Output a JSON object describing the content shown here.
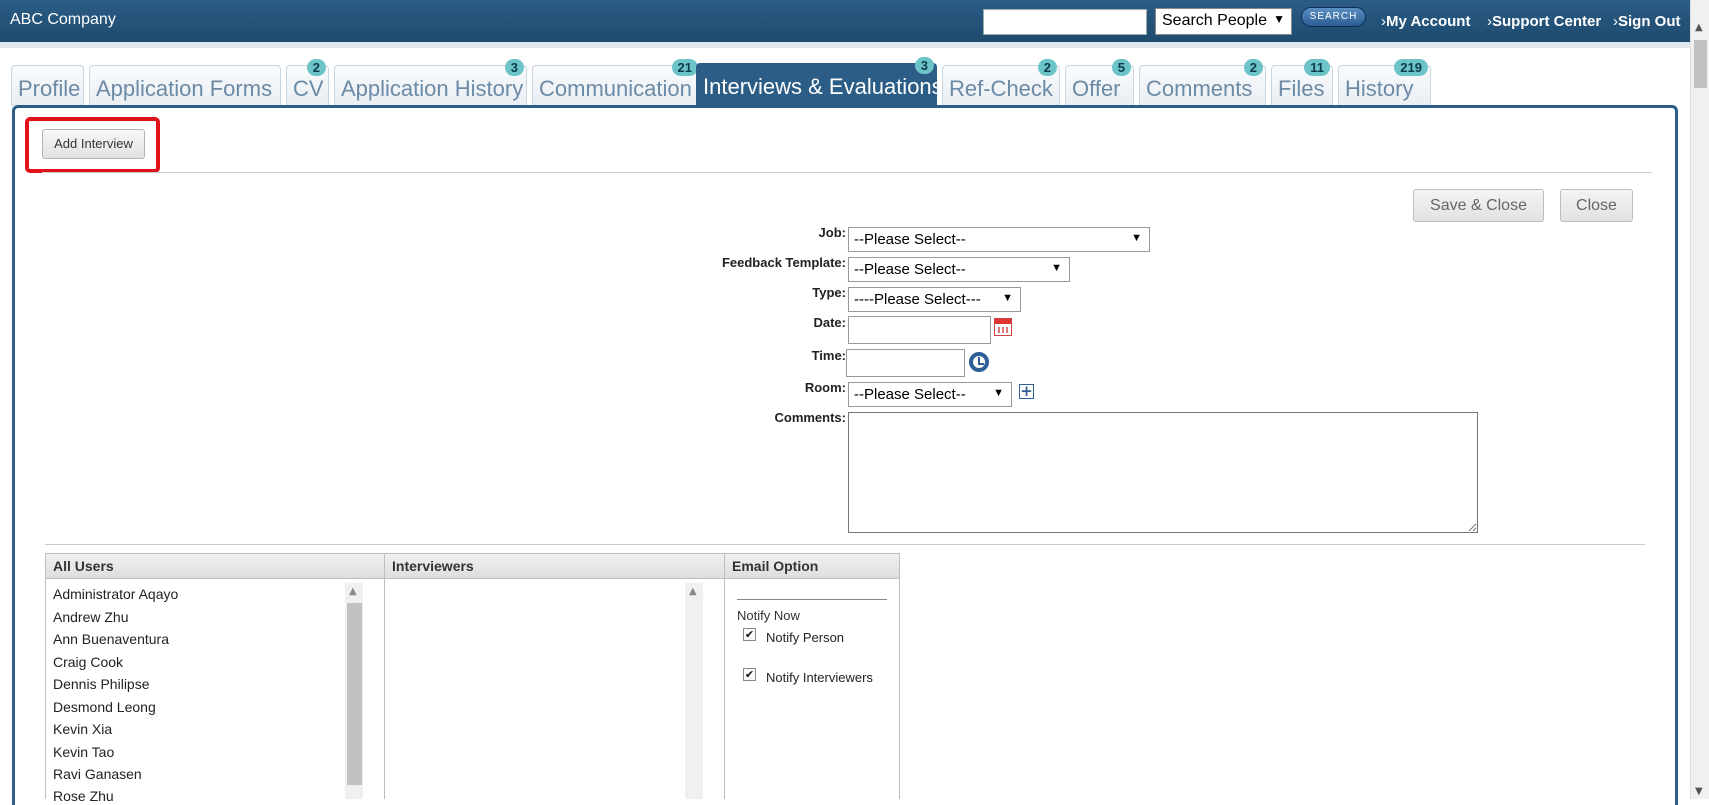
{
  "header": {
    "brand": "ABC Company",
    "search_value": "",
    "search_scope": "Search People",
    "search_button": "SEARCH",
    "links": [
      "My Account",
      "Support Center",
      "Sign Out"
    ]
  },
  "tabs": [
    {
      "label": "Profile",
      "badge": ""
    },
    {
      "label": "Application Forms",
      "badge": ""
    },
    {
      "label": "CV",
      "badge": "2"
    },
    {
      "label": "Application History",
      "badge": "3"
    },
    {
      "label": "Communication",
      "badge": "21"
    },
    {
      "label": "Interviews & Evaluations",
      "badge": "3",
      "active": true
    },
    {
      "label": "Ref-Check",
      "badge": "2"
    },
    {
      "label": "Offer",
      "badge": "5"
    },
    {
      "label": "Comments",
      "badge": "2"
    },
    {
      "label": "Files",
      "badge": "11"
    },
    {
      "label": "History",
      "badge": "219"
    }
  ],
  "toolbar": {
    "add_interview": "Add Interview",
    "save_close": "Save & Close",
    "close": "Close"
  },
  "form": {
    "job_label": "Job:",
    "job_value": "--Please Select--",
    "feedback_label": "Feedback Template:",
    "feedback_value": "--Please Select--",
    "type_label": "Type:",
    "type_value": "----Please Select---",
    "date_label": "Date:",
    "date_value": "",
    "time_label": "Time:",
    "time_value": "",
    "room_label": "Room:",
    "room_value": "--Please Select--",
    "comments_label": "Comments:",
    "comments_value": ""
  },
  "users_grid": {
    "headers": [
      "All Users",
      "Interviewers",
      "Email Option"
    ],
    "all_users": [
      "Administrator Aqayo",
      "Andrew Zhu",
      "Ann Buenaventura",
      "Craig Cook",
      "Dennis Philipse",
      "Desmond Leong",
      "Kevin Xia",
      "Kevin Tao",
      "Ravi Ganasen",
      "Rose Zhu"
    ],
    "interviewers": []
  },
  "email_option": {
    "title": "Notify Now",
    "notify_person": "Notify Person",
    "notify_person_checked": true,
    "notify_interviewers": "Notify Interviewers",
    "notify_interviewers_checked": true
  },
  "colors": {
    "header_blue": "#2b5d86",
    "badge_teal": "#6cc4c9",
    "highlight_red": "#e2121b"
  }
}
